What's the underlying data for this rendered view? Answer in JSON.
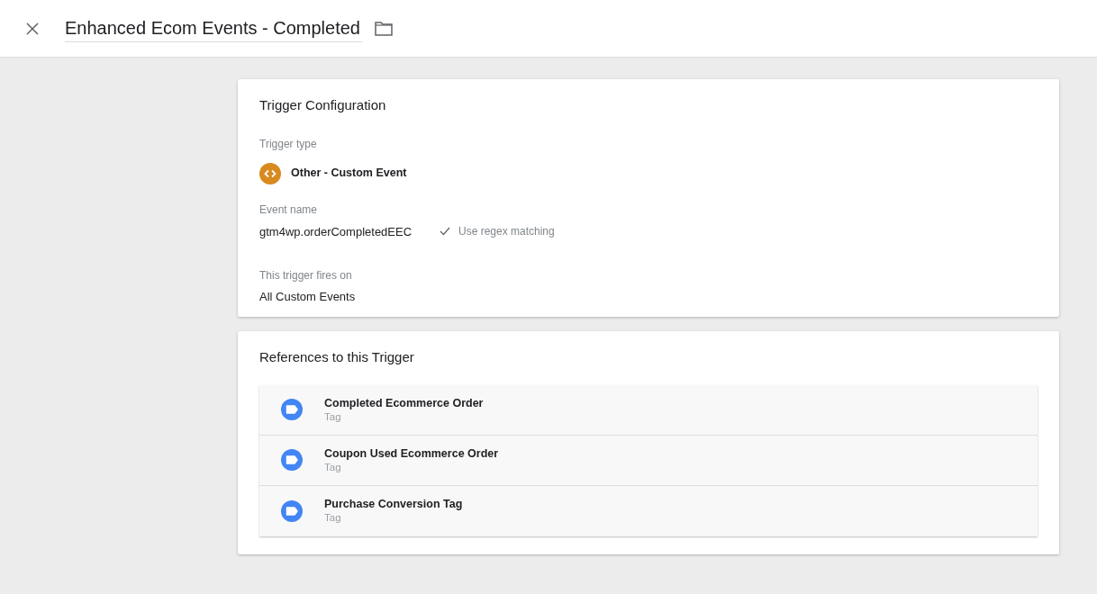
{
  "header": {
    "title": "Enhanced Ecom Events - Completed"
  },
  "trigger_configuration": {
    "heading": "Trigger Configuration",
    "trigger_type_label": "Trigger type",
    "trigger_type": "Other - Custom Event",
    "event_name_label": "Event name",
    "event_name": "gtm4wp.orderCompletedEEC",
    "regex": {
      "label": "Use regex matching",
      "checked": true
    },
    "fires_on_label": "This trigger fires on",
    "fires_on": "All Custom Events"
  },
  "references": {
    "heading": "References to this Trigger",
    "items": [
      {
        "name": "Completed Ecommerce Order",
        "type": "Tag"
      },
      {
        "name": "Coupon Used Ecommerce Order",
        "type": "Tag"
      },
      {
        "name": "Purchase Conversion Tag",
        "type": "Tag"
      }
    ]
  }
}
